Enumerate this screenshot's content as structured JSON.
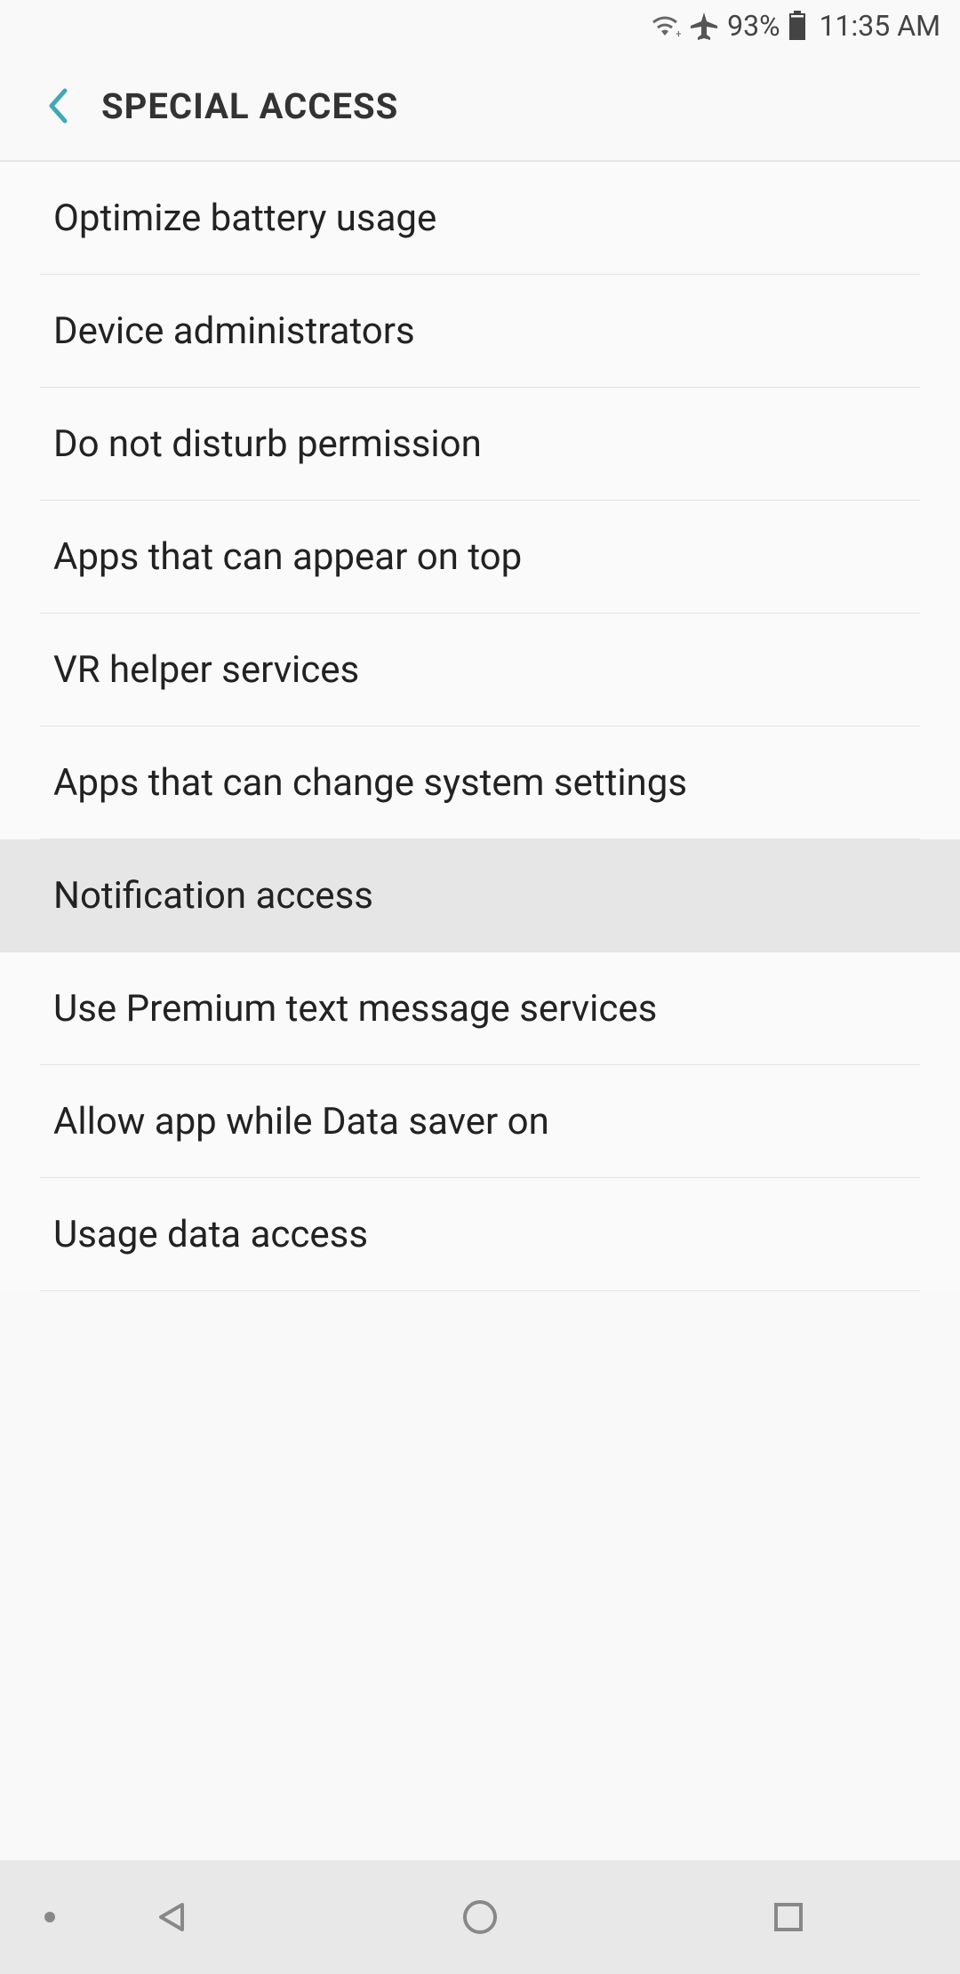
{
  "status_bar": {
    "battery_pct": "93%",
    "time": "11:35 AM"
  },
  "header": {
    "title": "SPECIAL ACCESS"
  },
  "list_items": [
    {
      "label": "Optimize battery usage",
      "highlighted": false
    },
    {
      "label": "Device administrators",
      "highlighted": false
    },
    {
      "label": "Do not disturb permission",
      "highlighted": false
    },
    {
      "label": "Apps that can appear on top",
      "highlighted": false
    },
    {
      "label": "VR helper services",
      "highlighted": false
    },
    {
      "label": "Apps that can change system settings",
      "highlighted": false
    },
    {
      "label": "Notification access",
      "highlighted": true
    },
    {
      "label": "Use Premium text message services",
      "highlighted": false
    },
    {
      "label": "Allow app while Data saver on",
      "highlighted": false
    },
    {
      "label": "Usage data access",
      "highlighted": false
    }
  ]
}
